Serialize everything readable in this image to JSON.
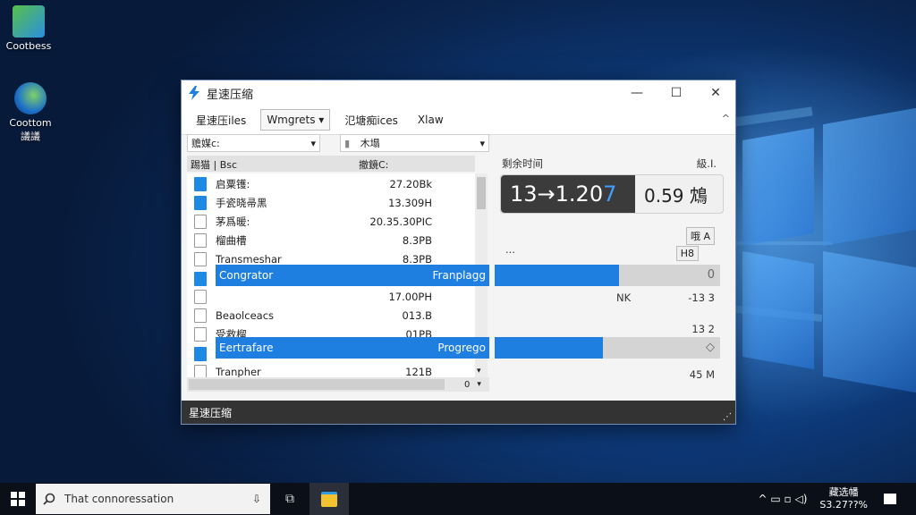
{
  "desktop": {
    "icons": [
      {
        "label": "Cootbess"
      },
      {
        "label": "Coottom\n議議"
      }
    ]
  },
  "window": {
    "title": "星速压缩",
    "controls": {
      "minimize": "—",
      "maximize": "☐",
      "close": "✕"
    },
    "menus": [
      {
        "label": "星速压iles"
      },
      {
        "label": "Wmgrets ▾"
      },
      {
        "label": "氾塘痴ices"
      },
      {
        "label": "Xlaw"
      }
    ],
    "collapse": "^",
    "filter": {
      "left": "赡媒c:",
      "left_arrow": "▾",
      "right_icon": "▮",
      "right": "木塌",
      "right_arrow": "▾"
    },
    "columns": {
      "name": "踢猫 | Bsc",
      "size": "撤鏡C:"
    },
    "files": [
      {
        "name": "启粟镬:",
        "size": "27.20Bk",
        "icon": "folder"
      },
      {
        "name": "手瓷晓帚黑",
        "size": "13.309H",
        "icon": "folder"
      },
      {
        "name": "茅爲暖:",
        "size": "20.35.30PIC",
        "icon": "doc"
      },
      {
        "name": "榴曲槽",
        "size": "8.3PB",
        "icon": "doc"
      },
      {
        "name": "Transmeshar",
        "size": "8.3PB",
        "icon": "doc"
      },
      {
        "name": "Congrator",
        "size": "",
        "icon": "folder"
      },
      {
        "name": "",
        "size": "17.00PH",
        "icon": "doc"
      },
      {
        "name": "Beaolceacs",
        "size": "013.B",
        "icon": "doc"
      },
      {
        "name": "受救榴",
        "size": "01PB",
        "icon": "doc"
      },
      {
        "name": "Eertrafare",
        "size": "",
        "icon": "folder"
      },
      {
        "name": "Tranpher",
        "size": "121B",
        "icon": "doc"
      }
    ],
    "hscroll_value": "0",
    "highlight1": {
      "name": "Congrator",
      "status": "Franplagg",
      "progress": 0.55,
      "end": "0"
    },
    "highlight2": {
      "name": "Eertrafare",
      "status": "Progrego",
      "progress": 0.48
    },
    "right": {
      "remaining_label": "剩余时间",
      "remaining_corner": "級.I.",
      "timer_main": "13→1.20",
      "timer_cursor": "7",
      "timer_secondary": "0.59 鴆",
      "badge_a": "哦 A",
      "badge_b": "H8",
      "dots": "...",
      "under1_left": "NK",
      "under1_right": "-13 3",
      "mid_value": "13 2",
      "bottom_value": "45 M"
    },
    "status": "星速压缩",
    "grip": "⋰"
  },
  "taskbar": {
    "search_placeholder": "That connoressation",
    "tray_time": "藏选幡",
    "tray_date": "S3.27??%",
    "tray_icons": "^  ▭  ▫  ◁)"
  },
  "colors": {
    "accent": "#1e7fe0",
    "status_bar": "#333333",
    "taskbar": "#0b0f18"
  }
}
